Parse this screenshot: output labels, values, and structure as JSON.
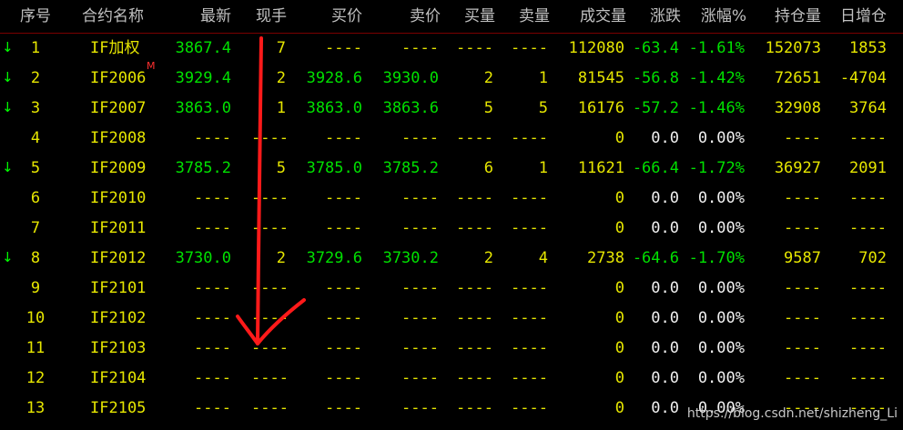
{
  "columns": {
    "index": "序号",
    "name": "合约名称",
    "last": "最新",
    "vol_now": "现手",
    "bid": "买价",
    "ask": "卖价",
    "bid_vol": "买量",
    "ask_vol": "卖量",
    "volume": "成交量",
    "change": "涨跌",
    "change_pct": "涨幅%",
    "open_interest": "持仓量",
    "oi_change": "日增仓"
  },
  "colors": {
    "background": "#000000",
    "up": "#ff3030",
    "down": "#00e000",
    "neutral": "#e6e600",
    "header": "#c0c0c0",
    "annotation_arrow": "#ff1a1a"
  },
  "rows": [
    {
      "down_arrow": true,
      "index": "1",
      "name": "IF加权",
      "marker": "",
      "last": "3867.4",
      "vol_now": "7",
      "bid": "----",
      "ask": "----",
      "bid_vol": "----",
      "ask_vol": "----",
      "volume": "112080",
      "change": "-63.4",
      "change_pct": "-1.61%",
      "open_interest": "152073",
      "oi_change": "1853"
    },
    {
      "down_arrow": true,
      "index": "2",
      "name": "IF2006",
      "marker": "M",
      "last": "3929.4",
      "vol_now": "2",
      "bid": "3928.6",
      "ask": "3930.0",
      "bid_vol": "2",
      "ask_vol": "1",
      "volume": "81545",
      "change": "-56.8",
      "change_pct": "-1.42%",
      "open_interest": "72651",
      "oi_change": "-4704"
    },
    {
      "down_arrow": true,
      "index": "3",
      "name": "IF2007",
      "marker": "",
      "last": "3863.0",
      "vol_now": "1",
      "bid": "3863.0",
      "ask": "3863.6",
      "bid_vol": "5",
      "ask_vol": "5",
      "volume": "16176",
      "change": "-57.2",
      "change_pct": "-1.46%",
      "open_interest": "32908",
      "oi_change": "3764"
    },
    {
      "down_arrow": false,
      "index": "4",
      "name": "IF2008",
      "marker": "",
      "last": "----",
      "vol_now": "----",
      "bid": "----",
      "ask": "----",
      "bid_vol": "----",
      "ask_vol": "----",
      "volume": "0",
      "change": "0.0",
      "change_pct": "0.00%",
      "open_interest": "----",
      "oi_change": "----"
    },
    {
      "down_arrow": true,
      "index": "5",
      "name": "IF2009",
      "marker": "",
      "last": "3785.2",
      "vol_now": "5",
      "bid": "3785.0",
      "ask": "3785.2",
      "bid_vol": "6",
      "ask_vol": "1",
      "volume": "11621",
      "change": "-66.4",
      "change_pct": "-1.72%",
      "open_interest": "36927",
      "oi_change": "2091"
    },
    {
      "down_arrow": false,
      "index": "6",
      "name": "IF2010",
      "marker": "",
      "last": "----",
      "vol_now": "----",
      "bid": "----",
      "ask": "----",
      "bid_vol": "----",
      "ask_vol": "----",
      "volume": "0",
      "change": "0.0",
      "change_pct": "0.00%",
      "open_interest": "----",
      "oi_change": "----"
    },
    {
      "down_arrow": false,
      "index": "7",
      "name": "IF2011",
      "marker": "",
      "last": "----",
      "vol_now": "----",
      "bid": "----",
      "ask": "----",
      "bid_vol": "----",
      "ask_vol": "----",
      "volume": "0",
      "change": "0.0",
      "change_pct": "0.00%",
      "open_interest": "----",
      "oi_change": "----"
    },
    {
      "down_arrow": true,
      "index": "8",
      "name": "IF2012",
      "marker": "",
      "last": "3730.0",
      "vol_now": "2",
      "bid": "3729.6",
      "ask": "3730.2",
      "bid_vol": "2",
      "ask_vol": "4",
      "volume": "2738",
      "change": "-64.6",
      "change_pct": "-1.70%",
      "open_interest": "9587",
      "oi_change": "702"
    },
    {
      "down_arrow": false,
      "index": "9",
      "name": "IF2101",
      "marker": "",
      "last": "----",
      "vol_now": "----",
      "bid": "----",
      "ask": "----",
      "bid_vol": "----",
      "ask_vol": "----",
      "volume": "0",
      "change": "0.0",
      "change_pct": "0.00%",
      "open_interest": "----",
      "oi_change": "----"
    },
    {
      "down_arrow": false,
      "index": "10",
      "name": "IF2102",
      "marker": "",
      "last": "----",
      "vol_now": "----",
      "bid": "----",
      "ask": "----",
      "bid_vol": "----",
      "ask_vol": "----",
      "volume": "0",
      "change": "0.0",
      "change_pct": "0.00%",
      "open_interest": "----",
      "oi_change": "----"
    },
    {
      "down_arrow": false,
      "index": "11",
      "name": "IF2103",
      "marker": "",
      "last": "----",
      "vol_now": "----",
      "bid": "----",
      "ask": "----",
      "bid_vol": "----",
      "ask_vol": "----",
      "volume": "0",
      "change": "0.0",
      "change_pct": "0.00%",
      "open_interest": "----",
      "oi_change": "----"
    },
    {
      "down_arrow": false,
      "index": "12",
      "name": "IF2104",
      "marker": "",
      "last": "----",
      "vol_now": "----",
      "bid": "----",
      "ask": "----",
      "bid_vol": "----",
      "ask_vol": "----",
      "volume": "0",
      "change": "0.0",
      "change_pct": "0.00%",
      "open_interest": "----",
      "oi_change": "----"
    },
    {
      "down_arrow": false,
      "index": "13",
      "name": "IF2105",
      "marker": "",
      "last": "----",
      "vol_now": "----",
      "bid": "----",
      "ask": "----",
      "bid_vol": "----",
      "ask_vol": "----",
      "volume": "0",
      "change": "0.0",
      "change_pct": "0.00%",
      "open_interest": "----",
      "oi_change": "----"
    }
  ],
  "watermark": "https://blog.csdn.net/shizheng_Li",
  "annotation": {
    "icon": "red-down-arrow-icon"
  }
}
